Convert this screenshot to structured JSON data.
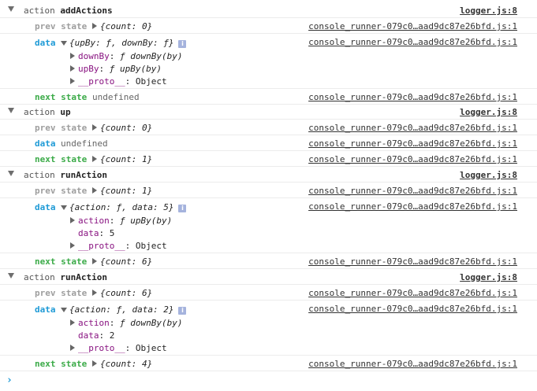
{
  "groups": [
    {
      "word": "action",
      "name": "addActions",
      "link": "logger.js:8",
      "prev": {
        "tag": "prev state",
        "value": "{count: 0}",
        "link": "console_runner-079c0…aad9dc87e26bfd.js:1"
      },
      "data": {
        "tag": "data",
        "value": "{upBy: ƒ, downBy: ƒ}",
        "link": "console_runner-079c0…aad9dc87e26bfd.js:1",
        "props": [
          {
            "key": "downBy",
            "value": "ƒ downBy(by)"
          },
          {
            "key": "upBy",
            "value": "ƒ upBy(by)"
          },
          {
            "key": "__proto__",
            "value": "Object"
          }
        ]
      },
      "next": {
        "tag": "next state",
        "value": "undefined",
        "link": "console_runner-079c0…aad9dc87e26bfd.js:1"
      }
    },
    {
      "word": "action",
      "name": "up",
      "link": "logger.js:8",
      "prev": {
        "tag": "prev state",
        "value": "{count: 0}",
        "link": "console_runner-079c0…aad9dc87e26bfd.js:1"
      },
      "data": {
        "tag": "data",
        "value": "undefined",
        "link": "console_runner-079c0…aad9dc87e26bfd.js:1"
      },
      "next": {
        "tag": "next state",
        "value": "{count: 1}",
        "link": "console_runner-079c0…aad9dc87e26bfd.js:1"
      }
    },
    {
      "word": "action",
      "name": "runAction",
      "link": "logger.js:8",
      "prev": {
        "tag": "prev state",
        "value": "{count: 1}",
        "link": "console_runner-079c0…aad9dc87e26bfd.js:1"
      },
      "data": {
        "tag": "data",
        "value": "{action: ƒ, data: 5}",
        "link": "console_runner-079c0…aad9dc87e26bfd.js:1",
        "props": [
          {
            "key": "action",
            "value": "ƒ upBy(by)"
          },
          {
            "key": "data",
            "value": "5"
          },
          {
            "key": "__proto__",
            "value": "Object"
          }
        ]
      },
      "next": {
        "tag": "next state",
        "value": "{count: 6}",
        "link": "console_runner-079c0…aad9dc87e26bfd.js:1"
      }
    },
    {
      "word": "action",
      "name": "runAction",
      "link": "logger.js:8",
      "prev": {
        "tag": "prev state",
        "value": "{count: 6}",
        "link": "console_runner-079c0…aad9dc87e26bfd.js:1"
      },
      "data": {
        "tag": "data",
        "value": "{action: ƒ, data: 2}",
        "link": "console_runner-079c0…aad9dc87e26bfd.js:1",
        "props": [
          {
            "key": "action",
            "value": "ƒ downBy(by)"
          },
          {
            "key": "data",
            "value": "2"
          },
          {
            "key": "__proto__",
            "value": "Object"
          }
        ]
      },
      "next": {
        "tag": "next state",
        "value": "{count: 4}",
        "link": "console_runner-079c0…aad9dc87e26bfd.js:1"
      }
    }
  ],
  "prompt": "›"
}
